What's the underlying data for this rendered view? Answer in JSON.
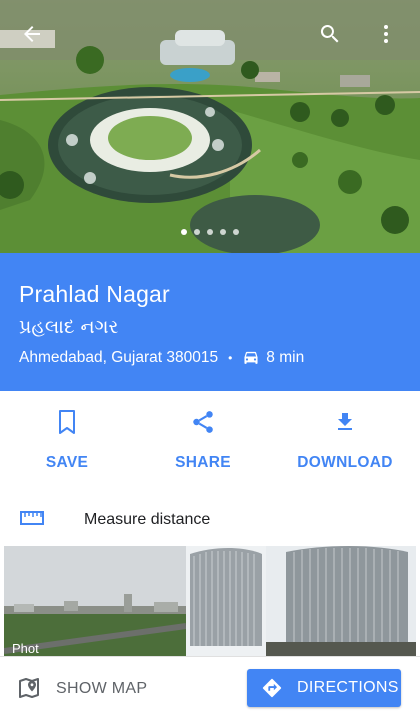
{
  "place": {
    "name": "Prahlad Nagar",
    "native_name": "પ્રહલાદ નગર",
    "address": "Ahmedabad, Gujarat 380015",
    "separator": "•",
    "travel_time": "8 min",
    "travel_mode_icon": "car-icon"
  },
  "topbar": {
    "icons": [
      "back-arrow-icon",
      "search-icon",
      "more-vert-icon"
    ]
  },
  "gallery": {
    "dot_count": 5,
    "active_dot": 0
  },
  "actions": [
    {
      "icon": "bookmark-icon",
      "label": "SAVE"
    },
    {
      "icon": "share-icon",
      "label": "SHARE"
    },
    {
      "icon": "download-icon",
      "label": "DOWNLOAD"
    }
  ],
  "measure": {
    "icon": "ruler-icon",
    "label": "Measure distance"
  },
  "photos": {
    "label": "Phot"
  },
  "bottom": {
    "show_map_label": "SHOW MAP",
    "directions_label": "DIRECTIONS"
  },
  "colors": {
    "accent": "#4285f4",
    "muted": "#5f6368"
  }
}
